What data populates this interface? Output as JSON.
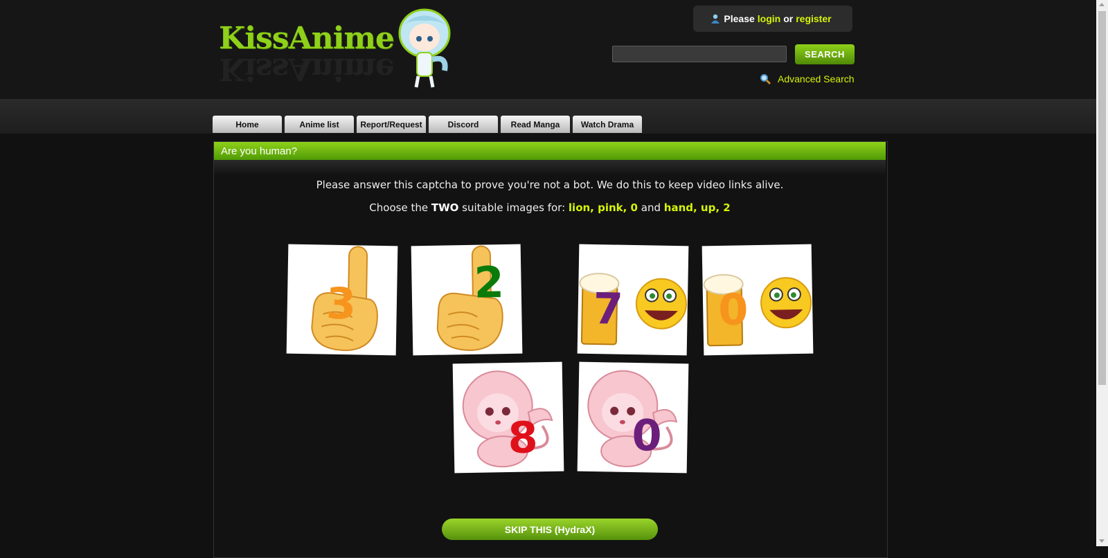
{
  "site": {
    "logo_text": "KissAnime"
  },
  "header": {
    "login_prefix": "Please",
    "login_label": "login",
    "or_text": "or",
    "register_label": "register",
    "search_placeholder": "",
    "search_button": "SEARCH",
    "advanced_search": "Advanced Search"
  },
  "nav": {
    "tabs": [
      {
        "label": "Home"
      },
      {
        "label": "Anime list"
      },
      {
        "label": "Report/Request"
      },
      {
        "label": "Discord"
      },
      {
        "label": "Read Manga"
      },
      {
        "label": "Watch Drama"
      }
    ]
  },
  "captcha": {
    "title": "Are you human?",
    "instruction": "Please answer this captcha to prove you're not a bot. We do this to keep video links alive.",
    "choose_prefix": "Choose the",
    "choose_count": "TWO",
    "choose_middle": "suitable images for:",
    "keyword_1": "lion, pink, 0",
    "and_text": "and",
    "keyword_2": "hand, up, 2",
    "images": [
      {
        "subject": "hand-up",
        "number": "3",
        "number_color": "#f7941d"
      },
      {
        "subject": "hand-up",
        "number": "2",
        "number_color": "#0a7a0a"
      },
      {
        "subject": "beer-smiley",
        "number": "7",
        "number_color": "#6b1f7b"
      },
      {
        "subject": "beer-smiley",
        "number": "0",
        "number_color": "#f7941d"
      },
      {
        "subject": "pink-lion",
        "number": "8",
        "number_color": "#e0101a"
      },
      {
        "subject": "pink-lion",
        "number": "0",
        "number_color": "#6b1f7b"
      }
    ],
    "skip_button": "SKIP THIS (HydraX)"
  },
  "colors": {
    "accent_green": "#8fd11a",
    "link_yellow": "#d5f406",
    "background": "#111111"
  }
}
